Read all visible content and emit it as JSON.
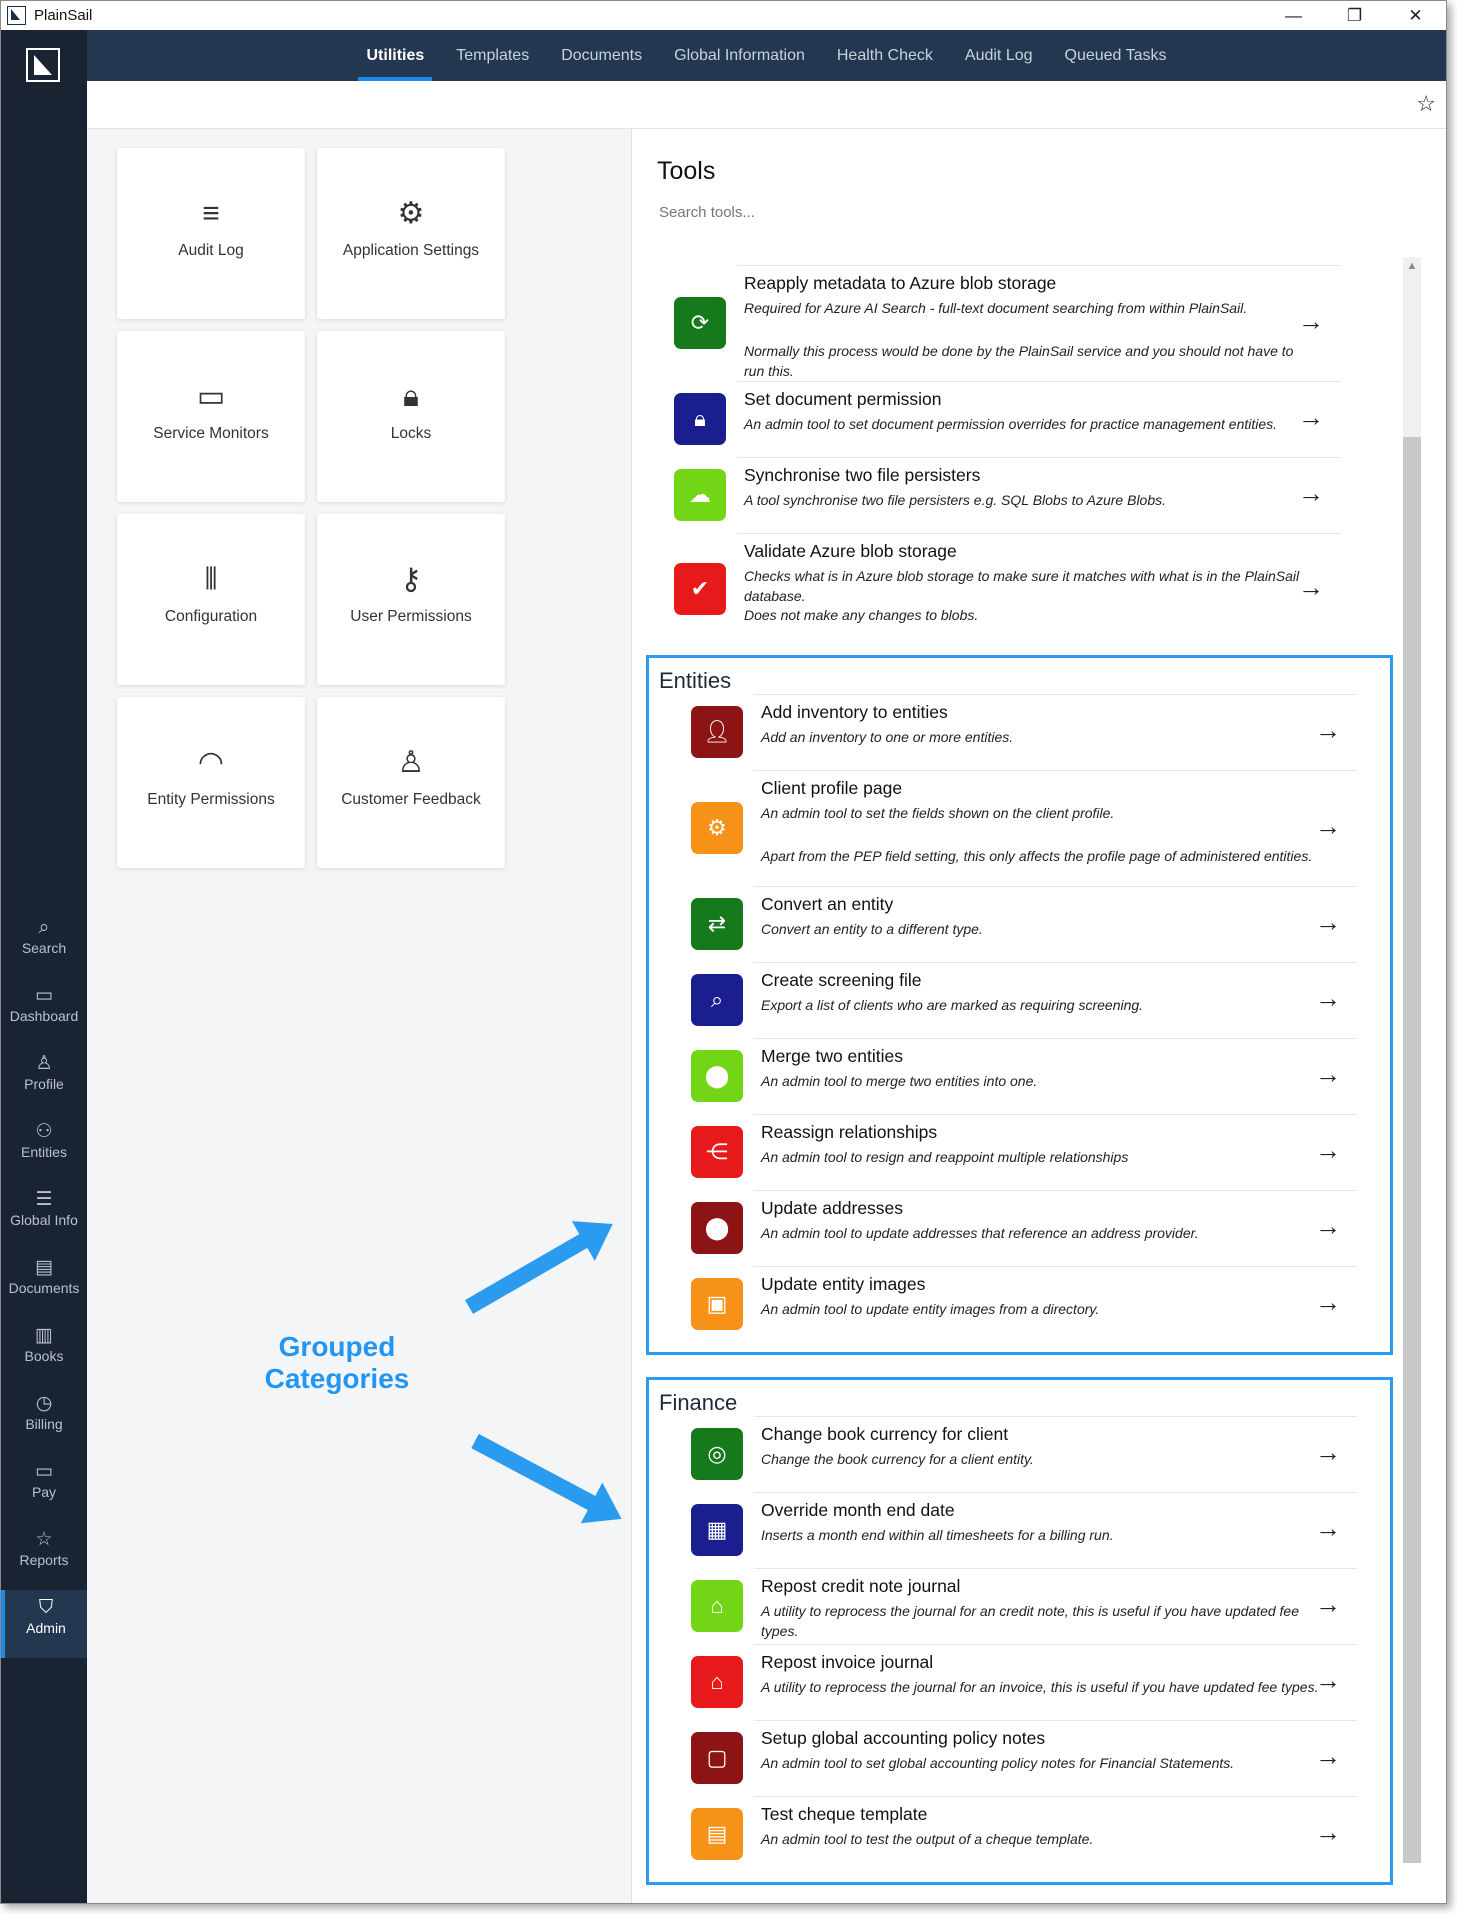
{
  "window": {
    "title": "PlainSail"
  },
  "nav_tabs": [
    "Utilities",
    "Templates",
    "Documents",
    "Global Information",
    "Health Check",
    "Audit Log",
    "Queued Tasks"
  ],
  "rail": [
    "Search",
    "Dashboard",
    "Profile",
    "Entities",
    "Global Info",
    "Documents",
    "Books",
    "Billing",
    "Pay",
    "Reports",
    "Admin"
  ],
  "tiles": [
    "Audit Log",
    "Application Settings",
    "Service Monitors",
    "Locks",
    "Configuration",
    "User Permissions",
    "Entity Permissions",
    "Customer Feedback"
  ],
  "panel": {
    "title": "Tools",
    "search_placeholder": "Search tools..."
  },
  "tools_top": [
    {
      "title": "Reapply metadata to Azure blob storage",
      "desc": "Required for Azure AI Search - full-text document searching from within PlainSail.",
      "desc2": "Normally this process would be done by the PlainSail service and you should not have to run this.",
      "color": "#16791b",
      "icon": "refresh-icon"
    },
    {
      "title": "Set document permission",
      "desc": "An admin tool to set document permission overrides for practice management entities.",
      "color": "#1a1e8e",
      "icon": "lock-icon"
    },
    {
      "title": "Synchronise two file persisters",
      "desc": "A tool synchronise two file persisters e.g. SQL Blobs to Azure Blobs.",
      "color": "#72d516",
      "icon": "cloud-icon"
    },
    {
      "title": "Validate Azure blob storage",
      "desc": "Checks what is in Azure blob storage to make sure it matches with what is in the PlainSail database.",
      "desc2": "Does not make any changes to blobs.",
      "color": "#e8191a",
      "icon": "check-icon"
    }
  ],
  "categories": [
    {
      "name": "Entities",
      "tools": [
        {
          "title": "Add inventory to entities",
          "desc": "Add an inventory to one or more entities.",
          "color": "#8d1414",
          "icon": "add-user-icon"
        },
        {
          "title": "Client profile page",
          "desc": "An admin tool to set the fields shown on the client profile.",
          "desc2": "Apart from the PEP field setting, this only affects the profile page of administered entities.",
          "color": "#f79218",
          "icon": "settings-icon"
        },
        {
          "title": "Convert an entity",
          "desc": "Convert an entity to a different type.",
          "color": "#16791b",
          "icon": "convert-icon"
        },
        {
          "title": "Create screening file",
          "desc": "Export a list of clients who are marked as requiring screening.",
          "color": "#1a1e8e",
          "icon": "search-icon"
        },
        {
          "title": "Merge two entities",
          "desc": "An admin tool to merge two entities into one.",
          "color": "#72d516",
          "icon": "merge-icon"
        },
        {
          "title": "Reassign relationships",
          "desc": "An admin tool to resign and reappoint multiple relationships",
          "color": "#e8191a",
          "icon": "share-icon"
        },
        {
          "title": "Update addresses",
          "desc": "An admin tool to update addresses that reference an address provider.",
          "color": "#8d1414",
          "icon": "pin-icon"
        },
        {
          "title": "Update entity images",
          "desc": "An admin tool to update entity images from a directory.",
          "color": "#f79218",
          "icon": "image-icon"
        }
      ]
    },
    {
      "name": "Finance",
      "tools": [
        {
          "title": "Change book currency for client",
          "desc": "Change the book currency for a client entity.",
          "color": "#16791b",
          "icon": "currency-icon"
        },
        {
          "title": "Override month end date",
          "desc": "Inserts a month end within all timesheets for a billing run.",
          "color": "#1a1e8e",
          "icon": "calendar-icon"
        },
        {
          "title": "Repost credit note journal",
          "desc": "A utility to reprocess the journal for an credit note, this is useful if you have updated fee types.",
          "color": "#72d516",
          "icon": "bank-icon"
        },
        {
          "title": "Repost invoice journal",
          "desc": "A utility to reprocess the journal for an invoice, this is useful if you have updated fee types.",
          "color": "#e8191a",
          "icon": "bank-icon"
        },
        {
          "title": "Setup global accounting policy notes",
          "desc": "An admin tool to set global accounting policy notes for Financial Statements.",
          "color": "#8d1414",
          "icon": "note-icon"
        },
        {
          "title": "Test cheque template",
          "desc": "An admin tool to test the output of a cheque template.",
          "color": "#f79218",
          "icon": "cheque-icon"
        }
      ]
    }
  ],
  "annotation": {
    "line1": "Grouped",
    "line2": "Categories"
  }
}
